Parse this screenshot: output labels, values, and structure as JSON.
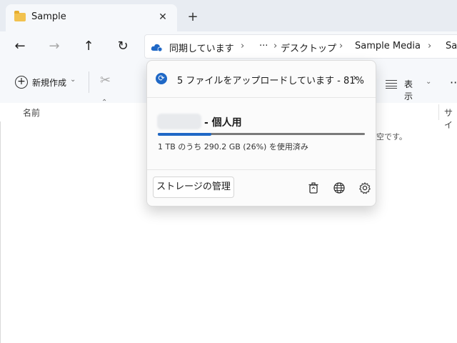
{
  "tab": {
    "title": "Sample",
    "close_glyph": "✕",
    "new_tab_glyph": "+"
  },
  "nav": {
    "back": "←",
    "forward": "→",
    "up": "↑",
    "refresh": "↻"
  },
  "address": {
    "sync_label": "同期しています",
    "overflow": "···",
    "crumbs": [
      "デスクトップ",
      "Sample Media",
      "Sa"
    ]
  },
  "toolbar": {
    "new_label": "新規作成",
    "view_label": "表示",
    "more": "··"
  },
  "columns": {
    "name": "名前",
    "size": "サイ"
  },
  "content": {
    "empty_text": "空です。"
  },
  "flyout": {
    "status": "5 ファイルをアップロードしています - 81%",
    "account_label": "- 個人用",
    "storage_used_fraction": 0.26,
    "storage_text": "1 TB のうち 290.2 GB (26%) を使用済み",
    "manage_button": "ストレージの管理",
    "icons": [
      "recycle-bin-icon",
      "globe-icon",
      "gear-icon"
    ]
  },
  "colors": {
    "accent": "#1f68c6",
    "folder": "#f2c24f"
  }
}
